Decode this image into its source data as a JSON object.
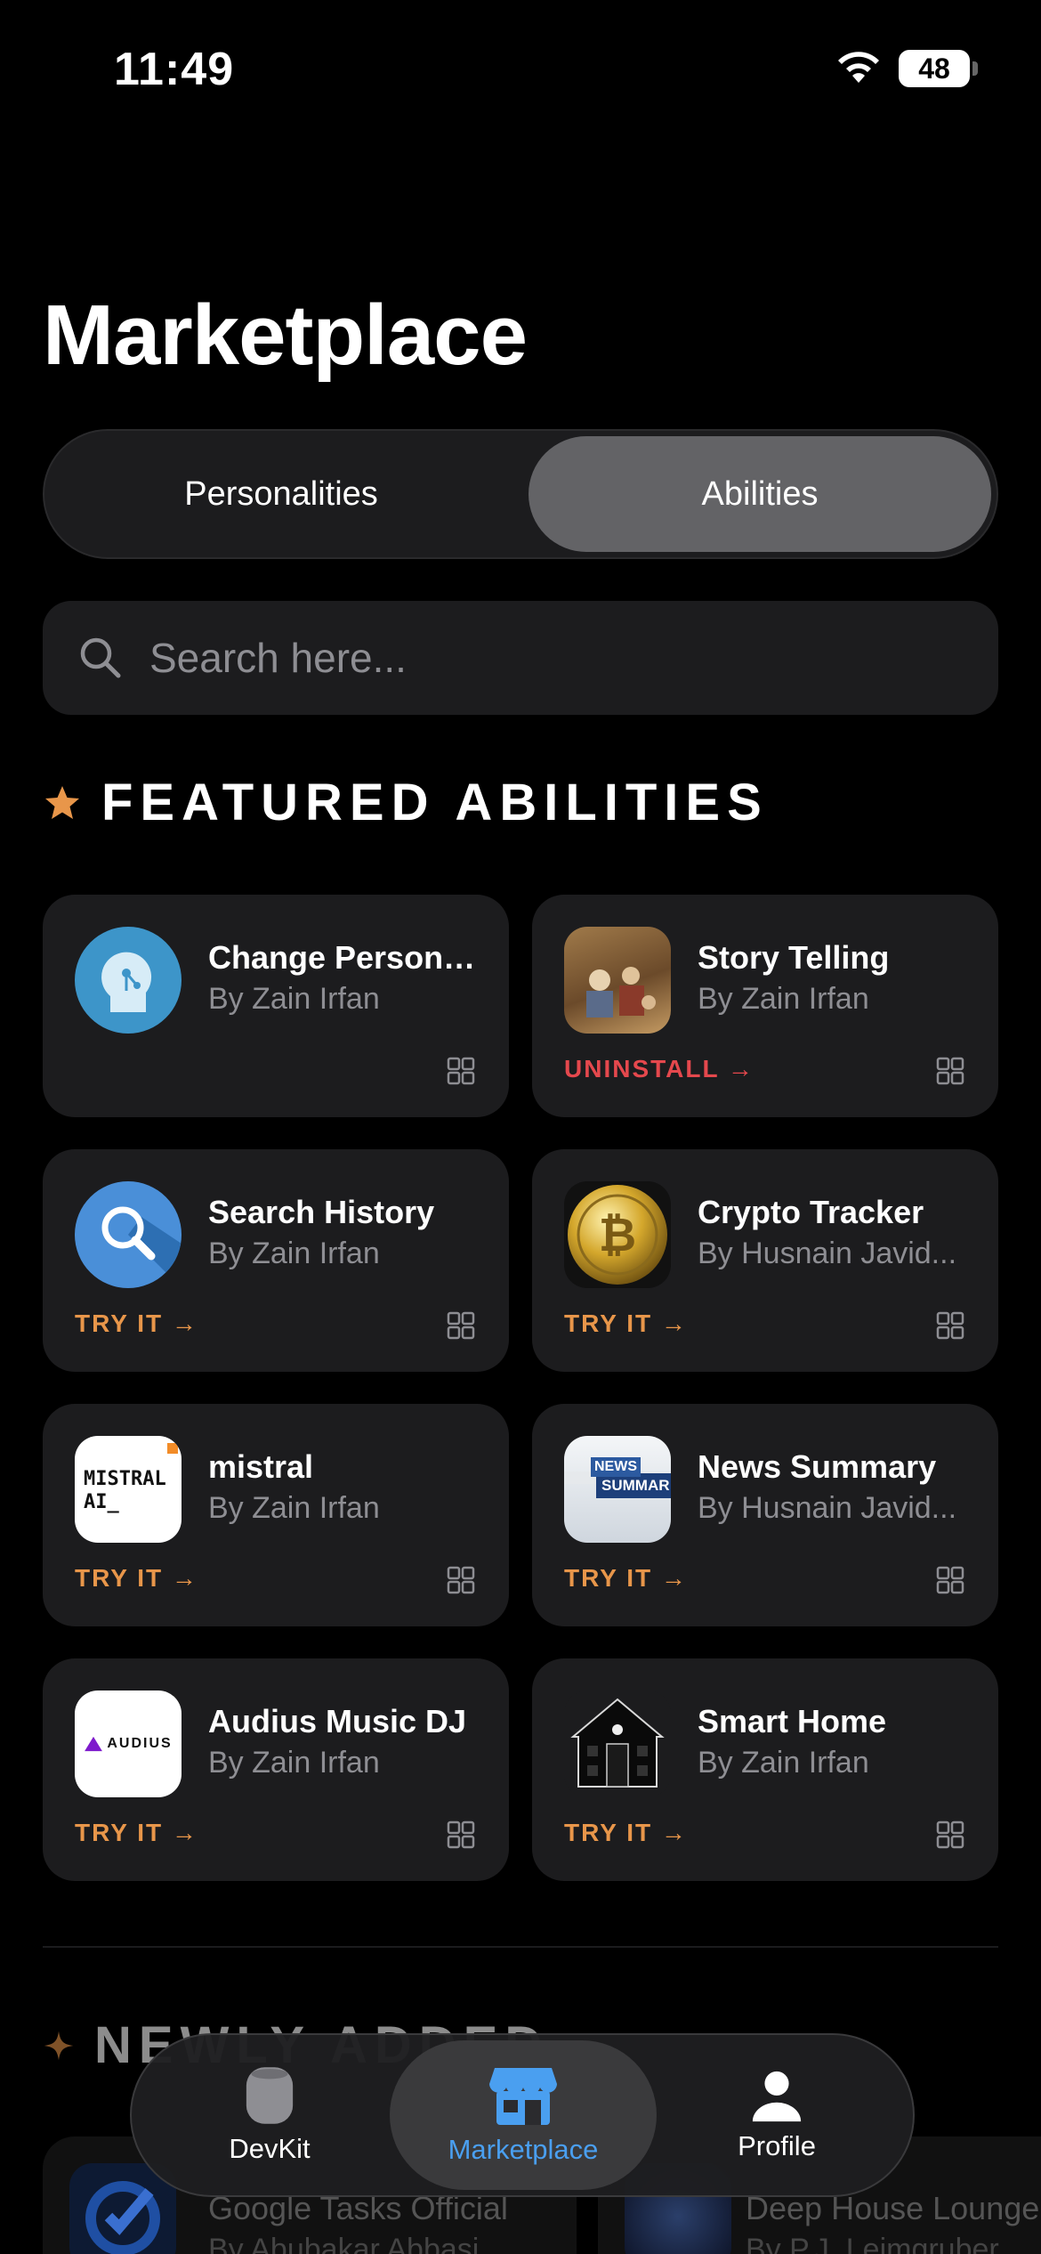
{
  "status_bar": {
    "time": "11:49",
    "battery": "48"
  },
  "page_title": "Marketplace",
  "segments": {
    "left": "Personalities",
    "right": "Abilities",
    "selected": "Abilities"
  },
  "search": {
    "placeholder": "Search here..."
  },
  "featured": {
    "heading": "FEATURED ABILITIES",
    "cards": [
      {
        "name": "Change Persona...",
        "author": "By Zain Irfan",
        "action": ""
      },
      {
        "name": "Story Telling",
        "author": "By Zain Irfan",
        "action": "UNINSTALL →"
      },
      {
        "name": "Search History",
        "author": "By Zain Irfan",
        "action": "TRY IT →"
      },
      {
        "name": "Crypto Tracker",
        "author": "By Husnain Javid...",
        "action": "TRY IT →"
      },
      {
        "name": "mistral",
        "author": "By Zain Irfan",
        "action": "TRY IT →",
        "logo_text_1": "MISTRAL",
        "logo_text_2": "AI_"
      },
      {
        "name": "News Summary",
        "author": "By Husnain Javid...",
        "action": "TRY IT →",
        "logo_text_1": "NEWS",
        "logo_text_2": "SUMMAR"
      },
      {
        "name": "Audius Music DJ",
        "author": "By Zain Irfan",
        "action": "TRY IT →",
        "logo_text_1": "AUDIUS"
      },
      {
        "name": "Smart Home",
        "author": "By Zain Irfan",
        "action": "TRY IT →"
      }
    ]
  },
  "newly_added": {
    "heading": "NEWLY ADDED",
    "cards": [
      {
        "name": "Google Tasks Official",
        "author": "By Abubakar Abbasi"
      },
      {
        "name": "Deep House Lounge",
        "author": "By P.J. Leimgruber"
      }
    ]
  },
  "tabbar": {
    "items": [
      {
        "label": "DevKit",
        "icon": "devkit-speaker-icon"
      },
      {
        "label": "Marketplace",
        "icon": "store-icon"
      },
      {
        "label": "Profile",
        "icon": "person-icon"
      }
    ],
    "active": "Marketplace"
  },
  "colors": {
    "accent_orange": "#e8964a",
    "uninstall_red": "#e5484d",
    "active_tab_blue": "#4a9ff0",
    "card_bg": "#1c1c1e"
  }
}
